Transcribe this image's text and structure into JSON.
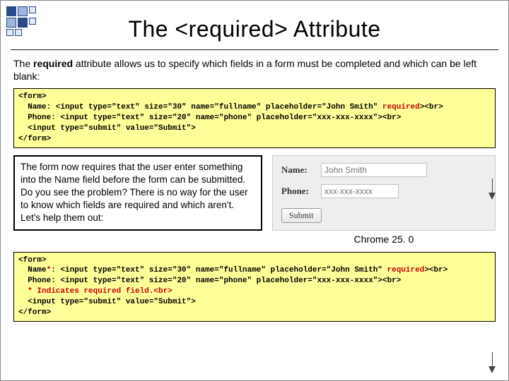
{
  "title": "The <required> Attribute",
  "intro": {
    "pre": "The ",
    "bold": "required",
    "post": " attribute allows us to specify which fields in a form must be completed and which can be left blank:"
  },
  "code1": {
    "l1": "<form>",
    "l2a": "Name: <input type=\"text\" size=\"30\" name=\"fullname\" placeholder=\"John Smith\" ",
    "l2b": "required",
    "l2c": "><br>",
    "l3": "Phone: <input type=\"text\" size=\"20\" name=\"phone\" placeholder=\"xxx-xxx-xxxx\"><br>",
    "l4": "<input type=\"submit\" value=\"Submit\">",
    "l5": "</form>"
  },
  "explain": "The form now requires that the user enter something into the Name field before the form can be submitted.  Do you see the problem?  There is no way for the user to know which fields are required and which aren't.  Let's help them out:",
  "preview": {
    "name_label": "Name:",
    "name_placeholder": "John Smith",
    "phone_label": "Phone:",
    "phone_placeholder": "xxx-xxx-xxxx",
    "submit": "Submit",
    "caption": "Chrome 25. 0"
  },
  "code2": {
    "l1": "<form>",
    "l2a": "Name",
    "l2b": "*",
    "l2c": ": <input type=\"text\" size=\"30\" name=\"fullname\" placeholder=\"John Smith\" ",
    "l2d": "required",
    "l2e": "><br>",
    "l3": "Phone: <input type=\"text\" size=\"20\" name=\"phone\" placeholder=\"xxx-xxx-xxxx\"><br>",
    "l4": "* Indicates required field.<br>",
    "l5": "<input type=\"submit\" value=\"Submit\">",
    "l6": "</form>"
  }
}
